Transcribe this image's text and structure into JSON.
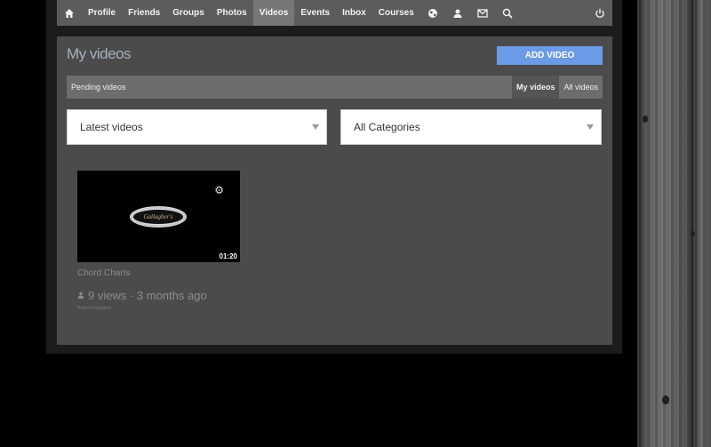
{
  "nav": {
    "home_icon": "home-icon",
    "items": [
      "Profile",
      "Friends",
      "Groups",
      "Photos",
      "Videos",
      "Events",
      "Inbox",
      "Courses"
    ],
    "active": "Videos",
    "icons": [
      "globe-icon",
      "user-add-icon",
      "envelope-icon",
      "search-icon"
    ],
    "logout_icon": "power-icon"
  },
  "page": {
    "title": "My videos",
    "add_button": "ADD VIDEO"
  },
  "subnav": {
    "pending": "Pending videos",
    "tabs": [
      "My videos",
      "All videos"
    ],
    "active_tab": "My videos"
  },
  "filters": {
    "sort": "Latest videos",
    "category": "All Categories"
  },
  "video": {
    "logo_text": "Gallagher's",
    "duration": "01:20",
    "title": "Chord Charts",
    "meta": "9 views · 3 months ago",
    "author": "Robert Gallagher"
  },
  "colors": {
    "accent": "#6b9be7",
    "nav_bg": "#5c5c5c",
    "panel_bg": "#4b4b4b",
    "title_color": "#a4b0bd"
  }
}
